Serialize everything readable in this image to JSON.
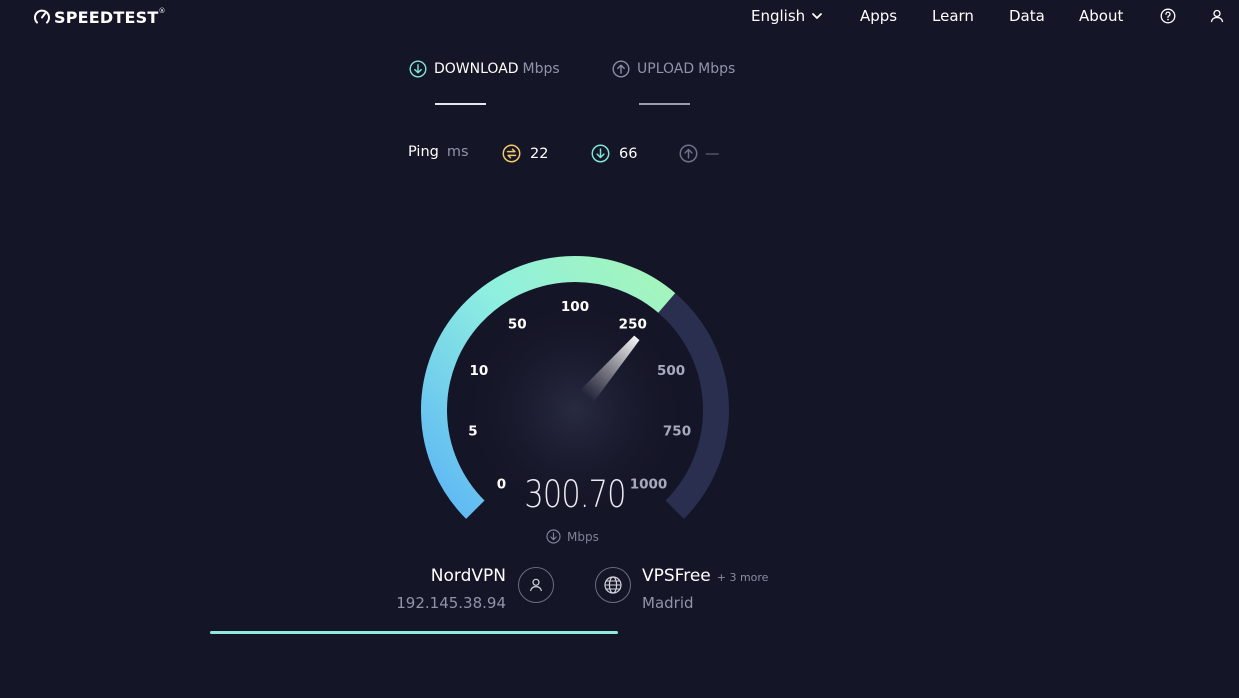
{
  "header": {
    "logo_text": "SPEEDTEST",
    "logo_tm": "®",
    "nav": {
      "language": "English",
      "apps": "Apps",
      "learn": "Learn",
      "data": "Data",
      "about": "About"
    },
    "icons": [
      "help-icon",
      "user-icon"
    ]
  },
  "tabs": {
    "download": {
      "label": "DOWNLOAD",
      "unit": "Mbps"
    },
    "upload": {
      "label": "UPLOAD",
      "unit": "Mbps"
    }
  },
  "ping": {
    "label": "Ping",
    "unit": "ms",
    "idle": "22",
    "download": "66",
    "upload": "—"
  },
  "gauge": {
    "value": "300.70",
    "unit": "Mbps",
    "reading_mbps": 300.7,
    "ticks": [
      "0",
      "5",
      "10",
      "50",
      "100",
      "250",
      "500",
      "750",
      "1000"
    ],
    "colors": {
      "arc_start": "#5fb8f4",
      "arc_mid": "#8ff0e0",
      "arc_end": "#a6f5b8",
      "track": "#2a2e4f"
    }
  },
  "server": {
    "isp_name": "NordVPN",
    "isp_ip": "192.145.38.94",
    "host_name": "VPSFree",
    "host_more": "+ 3 more",
    "host_location": "Madrid"
  },
  "progress": {
    "fraction": 1.0,
    "color": "#8ee8e0"
  }
}
